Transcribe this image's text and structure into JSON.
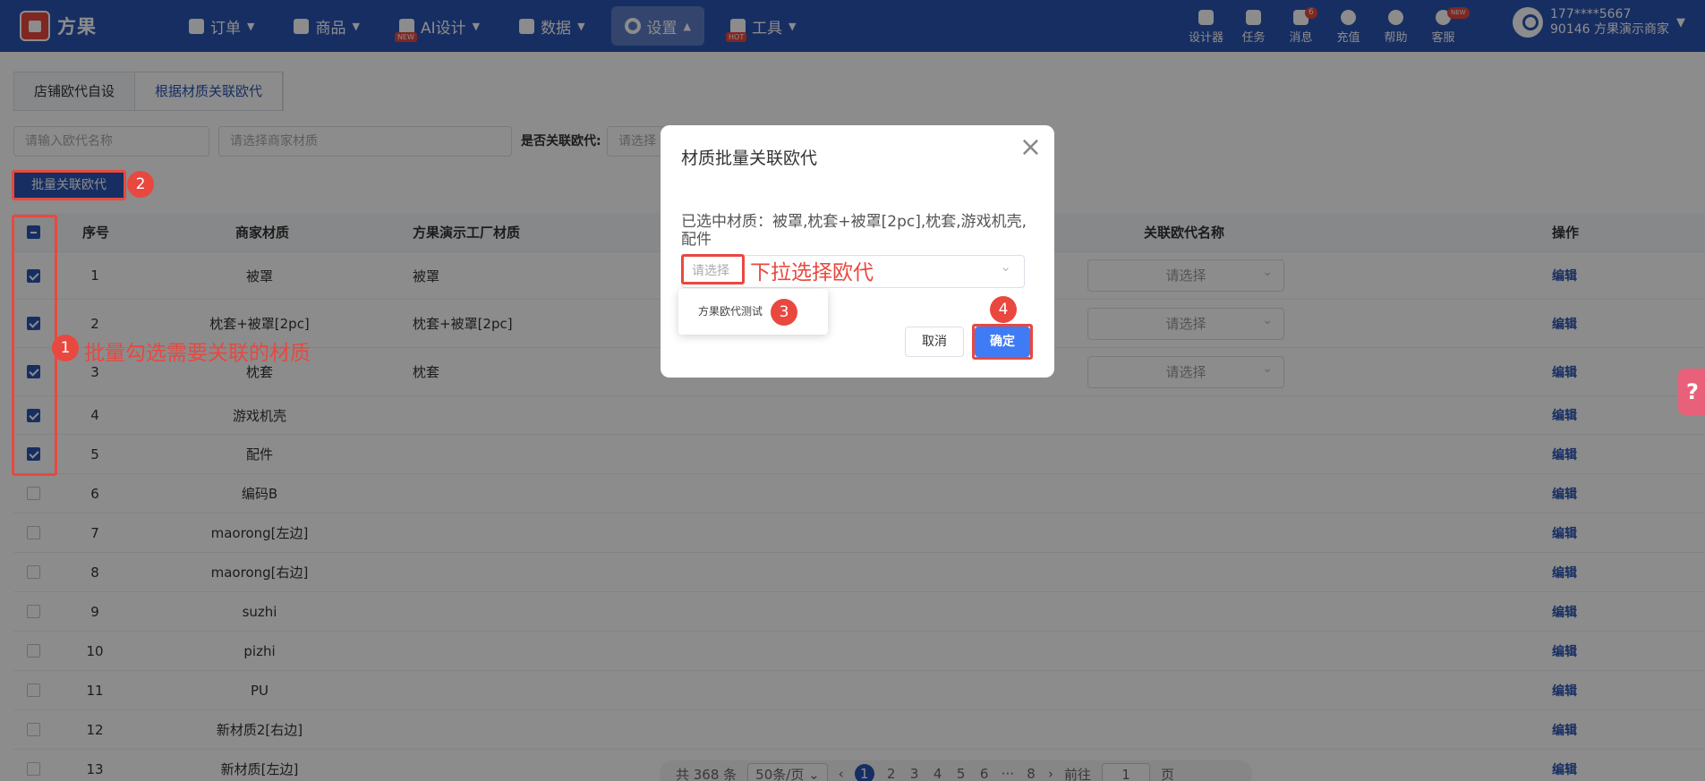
{
  "brand": {
    "name": "方果"
  },
  "nav": [
    {
      "label": "订单",
      "icon": "clipboard-icon"
    },
    {
      "label": "商品",
      "icon": "shirt-icon"
    },
    {
      "label": "AI设计",
      "icon": "ai-icon",
      "tag": "NEW"
    },
    {
      "label": "数据",
      "icon": "chart-icon"
    },
    {
      "label": "设置",
      "icon": "gear-icon",
      "active": true
    },
    {
      "label": "工具",
      "icon": "box-icon",
      "tag": "HOT"
    }
  ],
  "right_nav": [
    {
      "label": "设计器",
      "icon": "image-icon"
    },
    {
      "label": "任务",
      "icon": "task-icon"
    },
    {
      "label": "消息",
      "icon": "message-icon",
      "badge": "6"
    },
    {
      "label": "充值",
      "icon": "yen-icon"
    },
    {
      "label": "帮助",
      "icon": "question-icon"
    },
    {
      "label": "客服",
      "icon": "headset-icon",
      "badge": "NEW"
    }
  ],
  "user": {
    "phone": "177****5667",
    "account": "90146 方果演示商家"
  },
  "tabs": [
    {
      "label": "店铺欧代自设",
      "active": false
    },
    {
      "label": "根据材质关联欧代",
      "active": true
    }
  ],
  "filters": {
    "name_placeholder": "请输入欧代名称",
    "material_placeholder": "请选择商家材质",
    "linked_label": "是否关联欧代:",
    "linked_placeholder": "请选择"
  },
  "batch_button": "批量关联欧代",
  "table": {
    "headers": {
      "index": "序号",
      "merchant_material": "商家材质",
      "factory_material": "方果演示工厂材质",
      "linked_name": "关联欧代名称",
      "actions": "操作"
    },
    "select_placeholder": "请选择",
    "edit_label": "编辑",
    "rows": [
      {
        "index": "1",
        "merchant": "被罩",
        "factory": "被罩",
        "checked": true,
        "has_select": true
      },
      {
        "index": "2",
        "merchant": "枕套+被罩[2pc]",
        "factory": "枕套+被罩[2pc]",
        "checked": true,
        "has_select": true
      },
      {
        "index": "3",
        "merchant": "枕套",
        "factory": "枕套",
        "checked": true,
        "has_select": true
      },
      {
        "index": "4",
        "merchant": "游戏机壳",
        "factory": "",
        "checked": true,
        "has_select": false
      },
      {
        "index": "5",
        "merchant": "配件",
        "factory": "",
        "checked": true,
        "has_select": false
      },
      {
        "index": "6",
        "merchant": "编码B",
        "factory": "",
        "checked": false,
        "has_select": false
      },
      {
        "index": "7",
        "merchant": "maorong[左边]",
        "factory": "",
        "checked": false,
        "has_select": false
      },
      {
        "index": "8",
        "merchant": "maorong[右边]",
        "factory": "",
        "checked": false,
        "has_select": false
      },
      {
        "index": "9",
        "merchant": "suzhi",
        "factory": "",
        "checked": false,
        "has_select": false
      },
      {
        "index": "10",
        "merchant": "pizhi",
        "factory": "",
        "checked": false,
        "has_select": false
      },
      {
        "index": "11",
        "merchant": "PU",
        "factory": "",
        "checked": false,
        "has_select": false
      },
      {
        "index": "12",
        "merchant": "新材质2[右边]",
        "factory": "",
        "checked": false,
        "has_select": false
      },
      {
        "index": "13",
        "merchant": "新材质[左边]",
        "factory": "",
        "checked": false,
        "has_select": false
      }
    ]
  },
  "pagination": {
    "total": "共 368 条",
    "page_size": "50条/页",
    "pages": [
      "1",
      "2",
      "3",
      "4",
      "5",
      "6",
      "···",
      "8"
    ],
    "current": "1",
    "goto_label": "前往",
    "goto_value": "1",
    "page_unit": "页"
  },
  "modal": {
    "title": "材质批量关联欧代",
    "selected_info": "已选中材质：被罩,枕套+被罩[2pc],枕套,游戏机壳,配件",
    "select_placeholder": "请选择",
    "dropdown_option": "方果欧代测试",
    "cancel": "取消",
    "confirm": "确定"
  },
  "annotations": {
    "step1": "1",
    "step1_text": "批量勾选需要关联的材质",
    "step2": "2",
    "step3": "3",
    "step4": "4",
    "dropdown_hint": "下拉选择欧代"
  },
  "colors": {
    "brand": "#2a55b3",
    "accent_red": "#e9483f",
    "primary_button": "#3f7bf4"
  }
}
